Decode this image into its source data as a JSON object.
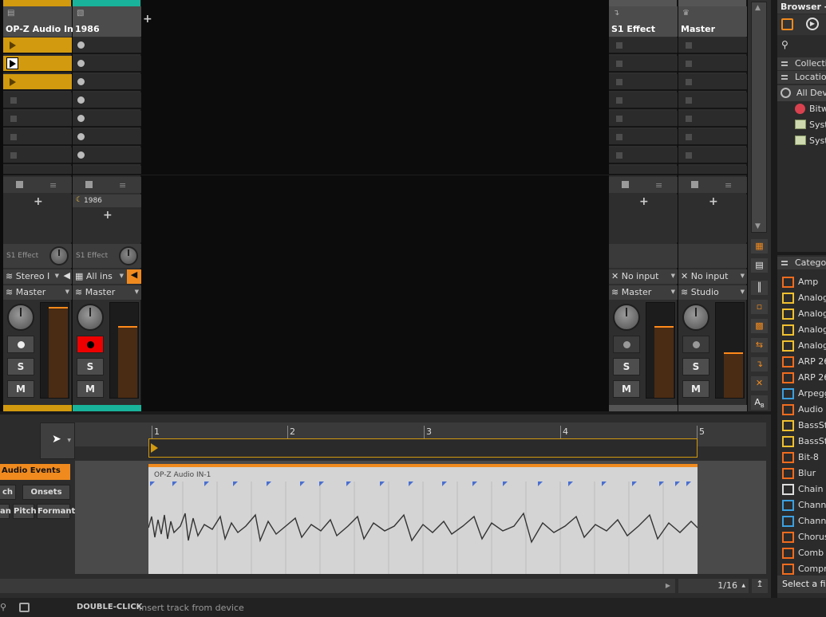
{
  "tracks": [
    {
      "name": "OP-Z Audio In",
      "type": "audio",
      "color": "#d29a0e",
      "device_label": "",
      "fx": "S1 Effect",
      "input": "Stereo I",
      "output": "Master",
      "record_armed": false,
      "meter_level": 0.96
    },
    {
      "name": "1986",
      "type": "instrument",
      "color": "#18b39a",
      "device_label": "1986",
      "fx": "S1 Effect",
      "input": "All ins",
      "output": "Master",
      "record_armed": true,
      "meter_level": 0.76
    },
    {
      "name": "S1 Effect",
      "type": "effect",
      "color": "",
      "device_label": "",
      "fx": "",
      "input": "No input",
      "output": "Master",
      "record_armed": false,
      "meter_level": 0.76
    },
    {
      "name": "Master",
      "type": "master",
      "color": "",
      "device_label": "",
      "fx": "",
      "input": "No input",
      "output": "Studio",
      "record_armed": false,
      "meter_level": 0.48
    }
  ],
  "buttons": {
    "solo": "S",
    "mute": "M"
  },
  "add_symbol": "+",
  "browser": {
    "title": "Browser - D",
    "collections": "Collectio",
    "locations": "Location",
    "all_devices": "All Devi",
    "location_items": [
      "Bitw",
      "Syst",
      "Syst"
    ],
    "categories_header": "Categor",
    "categories": [
      "Amp",
      "Analog",
      "Analog",
      "Analog",
      "Analog",
      "ARP 26",
      "ARP 26",
      "Arpegg",
      "Audio R",
      "BassSta",
      "BassSta",
      "Bit-8",
      "Blur",
      "Chain",
      "Channe",
      "Channe",
      "Chorus",
      "Comb",
      "Compre"
    ],
    "status": "Select a file"
  },
  "editor": {
    "audio_events": "Audio Events",
    "btn_stretch": "ch",
    "btn_onsets": "Onsets",
    "btn_pan": "an",
    "btn_pitch": "Pitch",
    "btn_formant": "Formant",
    "bars": [
      "1",
      "2",
      "3",
      "4",
      "5"
    ],
    "clip_name": "OP-Z Audio IN-1",
    "grid": "1/16"
  },
  "footer": {
    "action": "DOUBLE-CLICK",
    "description": "Insert track from device"
  },
  "colors": {
    "accent": "#f08a1e",
    "clip_yellow": "#d29a0e",
    "teal": "#18b39a",
    "record": "#e00000"
  }
}
